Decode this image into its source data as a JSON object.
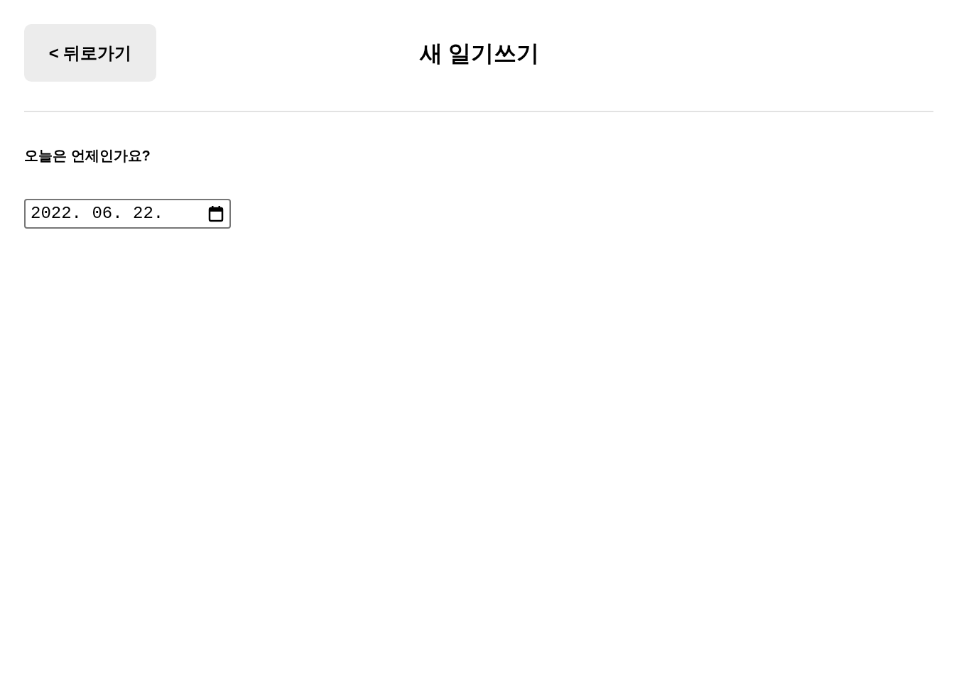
{
  "header": {
    "back_button": "< 뒤로가기",
    "title": "새 일기쓰기"
  },
  "date_section": {
    "label": "오늘은 언제인가요?",
    "date_field": {
      "value": "2022. 06. 22."
    }
  }
}
